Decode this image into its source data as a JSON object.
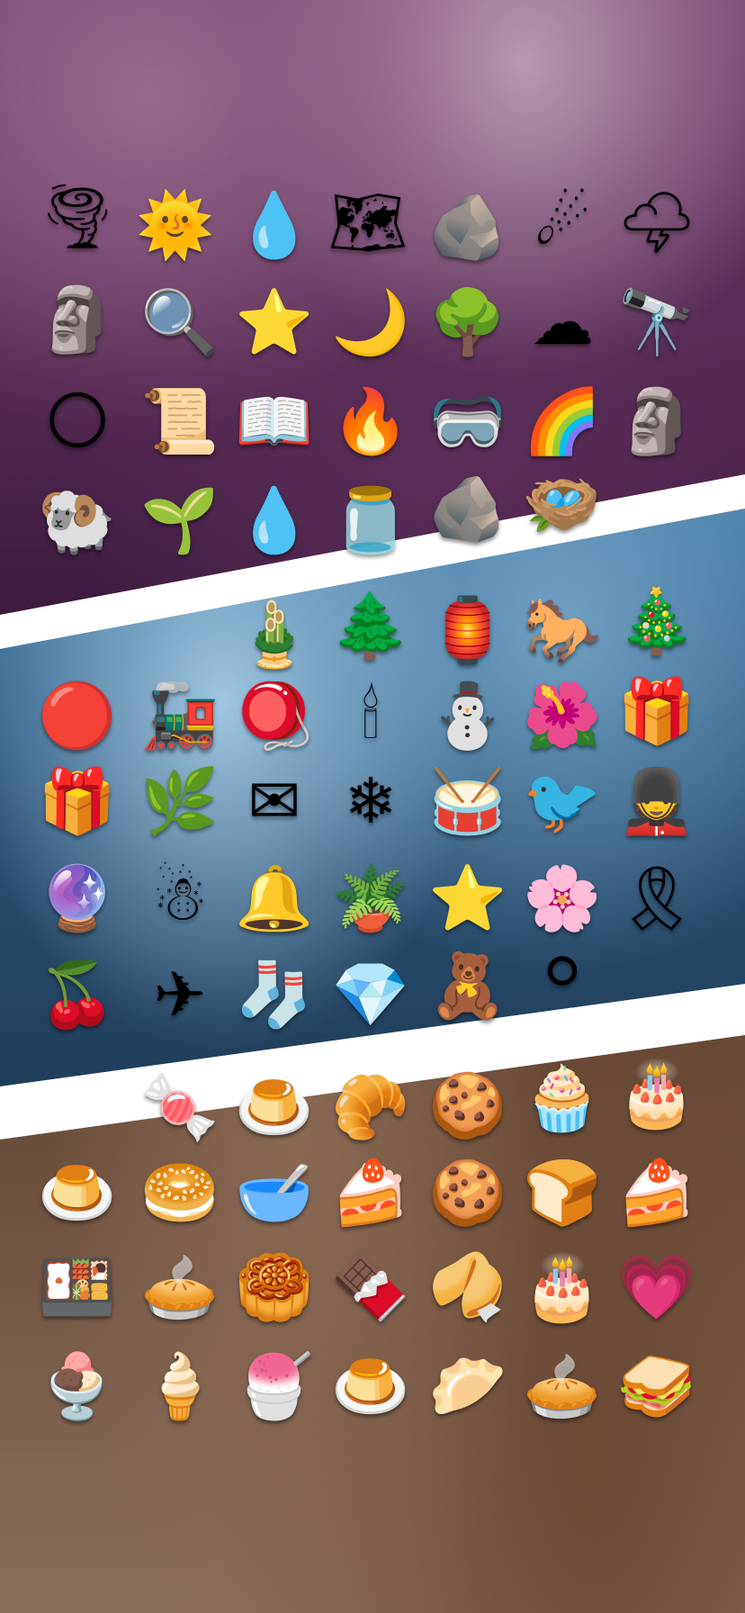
{
  "sections": [
    {
      "id": "magic",
      "items": [
        {
          "name": "tornado-icon",
          "glyph": "🌪"
        },
        {
          "name": "sun-charm-icon",
          "glyph": "🌞"
        },
        {
          "name": "slime-icon",
          "glyph": "💧"
        },
        {
          "name": "map-scroll-icon",
          "glyph": "🗺"
        },
        {
          "name": "ore-rock-icon",
          "glyph": "🪨"
        },
        {
          "name": "comet-icon",
          "glyph": "☄"
        },
        {
          "name": "storm-cloud-icon",
          "glyph": "🌩"
        },
        {
          "name": "stone-idol-icon",
          "glyph": "🗿"
        },
        {
          "name": "magnifier-icon",
          "glyph": "🔍"
        },
        {
          "name": "star-cookie-icon",
          "glyph": "⭐"
        },
        {
          "name": "moon-star-icon",
          "glyph": "🌙"
        },
        {
          "name": "tree-ent-icon",
          "glyph": "🌳"
        },
        {
          "name": "frozen-cloud-icon",
          "glyph": "☁"
        },
        {
          "name": "telescope-icon",
          "glyph": "🔭"
        },
        {
          "name": "moon-medallion-icon",
          "glyph": "🌕"
        },
        {
          "name": "red-scroll-icon",
          "glyph": "📜"
        },
        {
          "name": "star-book-icon",
          "glyph": "📖"
        },
        {
          "name": "fire-spirit-icon",
          "glyph": "🔥"
        },
        {
          "name": "goggles-icon",
          "glyph": "🥽"
        },
        {
          "name": "rainbow-cloud-icon",
          "glyph": "🌈"
        },
        {
          "name": "horned-idol-icon",
          "glyph": "🗿"
        },
        {
          "name": "cloud-beast-icon",
          "glyph": "🐏"
        },
        {
          "name": "sapling-icon",
          "glyph": "🌱"
        },
        {
          "name": "water-drop-icon",
          "glyph": "💧"
        },
        {
          "name": "specimen-jar-icon",
          "glyph": "🫙"
        },
        {
          "name": "meteor-rock-icon",
          "glyph": "🪨"
        },
        {
          "name": "nest-icon",
          "glyph": "🪺"
        }
      ]
    },
    {
      "id": "winter",
      "items": [
        {
          "name": "wreath-icon",
          "glyph": "🎍"
        },
        {
          "name": "snowy-pine-icon",
          "glyph": "🌲"
        },
        {
          "name": "lantern-icon",
          "glyph": "🏮"
        },
        {
          "name": "rocking-horse-icon",
          "glyph": "🐎"
        },
        {
          "name": "christmas-tree-icon",
          "glyph": "🎄"
        },
        {
          "name": "ornament-icon",
          "glyph": "🔴"
        },
        {
          "name": "toy-train-icon",
          "glyph": "🚂"
        },
        {
          "name": "spinning-top-icon",
          "glyph": "🪀"
        },
        {
          "name": "candle-icon",
          "glyph": "🕯"
        },
        {
          "name": "snowman-small-icon",
          "glyph": "⛄"
        },
        {
          "name": "poinsettia-icon",
          "glyph": "🌺"
        },
        {
          "name": "gold-gift-icon",
          "glyph": "🎁"
        },
        {
          "name": "blue-gift-icon",
          "glyph": "🎁"
        },
        {
          "name": "mistletoe-icon",
          "glyph": "🌿"
        },
        {
          "name": "sealed-letter-icon",
          "glyph": "✉"
        },
        {
          "name": "snowflake-icon",
          "glyph": "❄"
        },
        {
          "name": "drum-icon",
          "glyph": "🥁"
        },
        {
          "name": "blue-bird-icon",
          "glyph": "🐦"
        },
        {
          "name": "nutcracker-icon",
          "glyph": "💂"
        },
        {
          "name": "snow-globe-icon",
          "glyph": "🔮"
        },
        {
          "name": "snowman-scarf-icon",
          "glyph": "☃"
        },
        {
          "name": "bell-icon",
          "glyph": "🔔"
        },
        {
          "name": "succulent-icon",
          "glyph": "🪴"
        },
        {
          "name": "gold-star-icon",
          "glyph": "⭐"
        },
        {
          "name": "pink-flower-icon",
          "glyph": "🌸"
        },
        {
          "name": "ribbon-curl-icon",
          "glyph": "🎗"
        },
        {
          "name": "holly-icon",
          "glyph": "🍒"
        },
        {
          "name": "biplane-icon",
          "glyph": "✈"
        },
        {
          "name": "stocking-icon",
          "glyph": "🧦"
        },
        {
          "name": "ice-crystal-icon",
          "glyph": "💎"
        },
        {
          "name": "winter-doll-icon",
          "glyph": "🧸"
        },
        {
          "name": "snow-ball-icon",
          "glyph": "⚪"
        }
      ]
    },
    {
      "id": "bakery",
      "items": [
        {
          "name": "macarons-icon",
          "glyph": "🍬"
        },
        {
          "name": "jelly-icon",
          "glyph": "🍮"
        },
        {
          "name": "croissant-icon",
          "glyph": "🥐"
        },
        {
          "name": "jam-cookies-icon",
          "glyph": "🍪"
        },
        {
          "name": "cherry-cupcake-icon",
          "glyph": "🧁"
        },
        {
          "name": "chocolate-cake-icon",
          "glyph": "🎂"
        },
        {
          "name": "galaxy-pudding-icon",
          "glyph": "🍮"
        },
        {
          "name": "cream-bun-icon",
          "glyph": "🥯"
        },
        {
          "name": "cream-bowl-icon",
          "glyph": "🥣"
        },
        {
          "name": "matcha-cake-icon",
          "glyph": "🍰"
        },
        {
          "name": "choc-chip-cookies-icon",
          "glyph": "🍪"
        },
        {
          "name": "bunny-bread-icon",
          "glyph": "🍞"
        },
        {
          "name": "matcha-slice-icon",
          "glyph": "🍰"
        },
        {
          "name": "battenberg-icon",
          "glyph": "🍱"
        },
        {
          "name": "fruit-tart-icon",
          "glyph": "🥧"
        },
        {
          "name": "layered-pastry-icon",
          "glyph": "🥮"
        },
        {
          "name": "choc-sandwich-cookies-icon",
          "glyph": "🍫"
        },
        {
          "name": "biscuit-stack-icon",
          "glyph": "🥠"
        },
        {
          "name": "pink-layer-cake-icon",
          "glyph": "🎂"
        },
        {
          "name": "heart-roll-icon",
          "glyph": "💗"
        },
        {
          "name": "sundae-icon",
          "glyph": "🍨"
        },
        {
          "name": "soft-serve-icon",
          "glyph": "🍦"
        },
        {
          "name": "fruit-bowl-icon",
          "glyph": "🍧"
        },
        {
          "name": "flan-icon",
          "glyph": "🍮"
        },
        {
          "name": "choux-puff-icon",
          "glyph": "🥟"
        },
        {
          "name": "pie-icon",
          "glyph": "🥧"
        },
        {
          "name": "turnover-icon",
          "glyph": "🥪"
        }
      ]
    }
  ]
}
